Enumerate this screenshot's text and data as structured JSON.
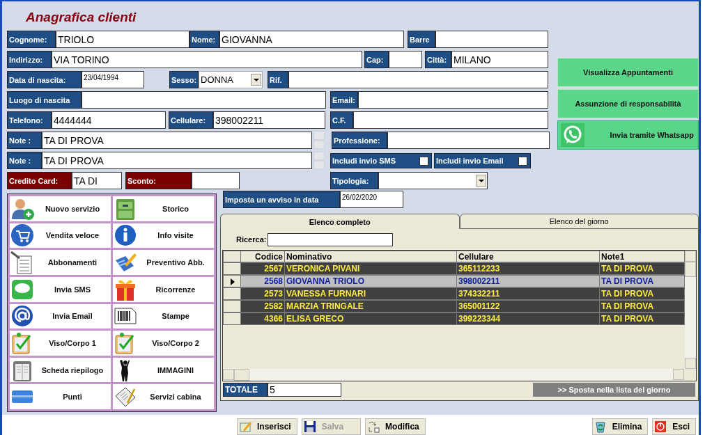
{
  "window": {
    "title": "Anagrafica clienti"
  },
  "form": {
    "rows": [
      [
        {
          "kind": "text",
          "label": "Cognome:",
          "value": "TRIOLO"
        },
        {
          "kind": "text",
          "label": "Nome:",
          "value": "GIOVANNA"
        },
        {
          "kind": "text",
          "label": "Barre"
        }
      ],
      [
        {
          "kind": "text",
          "label": "Indirizzo:",
          "value": "VIA TORINO"
        },
        {
          "kind": "text",
          "label": "Cap:"
        },
        {
          "kind": "text",
          "label": "Città:",
          "value": "MILANO"
        }
      ],
      [
        {
          "kind": "date",
          "label": "Data di nascita:",
          "value": "23/04/1994"
        },
        {
          "kind": "select",
          "label": "Sesso:",
          "value": "DONNA"
        },
        {
          "kind": "text",
          "label": "Rif."
        }
      ],
      [
        {
          "kind": "text",
          "label": "Luogo di nascita"
        },
        {
          "kind": "text",
          "label": "Email:"
        }
      ],
      [
        {
          "kind": "text",
          "label": "Telefono:",
          "value": "4444444"
        },
        {
          "kind": "text",
          "label": "Cellulare:",
          "value": "398002211"
        },
        {
          "kind": "text",
          "label": "C.F."
        }
      ],
      [
        {
          "kind": "memo",
          "label": "Note :",
          "value": "TA DI PROVA"
        },
        {
          "kind": "text",
          "label": "Professione:"
        }
      ],
      [
        {
          "kind": "memo",
          "label": "Note :",
          "value": "TA DI PROVA"
        },
        {
          "kind": "check",
          "label": "Includi invio SMS",
          "checked": false
        },
        {
          "kind": "check",
          "label": "Includi invio Email",
          "checked": false
        }
      ],
      [
        {
          "kind": "text",
          "label": "Credito Card:",
          "value": "TA DI",
          "highlighted": true
        },
        {
          "kind": "text",
          "label": "Sconto:",
          "highlighted": true
        },
        {
          "kind": "select",
          "label": "Tipologia:"
        }
      ]
    ]
  },
  "side_buttons": [
    {
      "label": "Visualizza Appuntamenti",
      "kind": "plain"
    },
    {
      "label": "Assunzione di responsabilità",
      "kind": "plain"
    },
    {
      "label": "Invia tramite Whatsapp",
      "kind": "whatsapp"
    }
  ],
  "menu": [
    {
      "label": "Nuovo servizio"
    },
    {
      "label": "Storico"
    },
    {
      "label": "Vendita veloce"
    },
    {
      "label": "Info visite"
    },
    {
      "label": "Abbonamenti"
    },
    {
      "label": "Preventivo Abb."
    },
    {
      "label": "Invia SMS"
    },
    {
      "label": "Ricorrenze"
    },
    {
      "label": "Invia Email"
    },
    {
      "label": "Stampe"
    },
    {
      "label": "Viso/Corpo 1"
    },
    {
      "label": "Viso/Corpo 2"
    },
    {
      "label": "Scheda riepilogo"
    },
    {
      "label": "IMMAGINI"
    },
    {
      "label": "Punti"
    },
    {
      "label": "Servizi cabina"
    }
  ],
  "reminder": {
    "label": "Imposta un avviso in data",
    "value": "26/02/2020"
  },
  "tabs": [
    {
      "label": "Elenco completo",
      "selected": true
    },
    {
      "label": "Elenco del giorno",
      "selected": false
    }
  ],
  "search": {
    "label": "Ricerca:"
  },
  "table": {
    "columns": [
      "Codice",
      "Nominativo",
      "Cellulare",
      "Note1"
    ],
    "rows": [
      {
        "cells": [
          "2567",
          "VERONICA PIVANI",
          "365112233",
          "TA DI PROVA"
        ],
        "selected": false
      },
      {
        "cells": [
          "2568",
          "GIOVANNA TRIOLO",
          "398002211",
          "TA DI PROVA"
        ],
        "selected": true
      },
      {
        "cells": [
          "2573",
          "VANESSA FURNARI",
          "374332211",
          "TA DI PROVA"
        ],
        "selected": false
      },
      {
        "cells": [
          "2582",
          "MARZIA TRINGALE",
          "365001122",
          "TA DI PROVA"
        ],
        "selected": false
      },
      {
        "cells": [
          "4366",
          "ELISA GRECO",
          "399223344",
          "TA DI PROVA"
        ],
        "selected": false
      }
    ]
  },
  "total": {
    "label": "TOTALE",
    "value": "5"
  },
  "move_button": {
    "label": ">> Sposta nella lista del giorno"
  },
  "toolbar_left": [
    {
      "label": "Inserisci",
      "disabled": false
    },
    {
      "label": "Salva",
      "disabled": true
    },
    {
      "label": "Modifica",
      "disabled": false
    }
  ],
  "toolbar_right": [
    {
      "label": "Elimina",
      "disabled": false
    },
    {
      "label": "Esci",
      "disabled": false
    }
  ]
}
